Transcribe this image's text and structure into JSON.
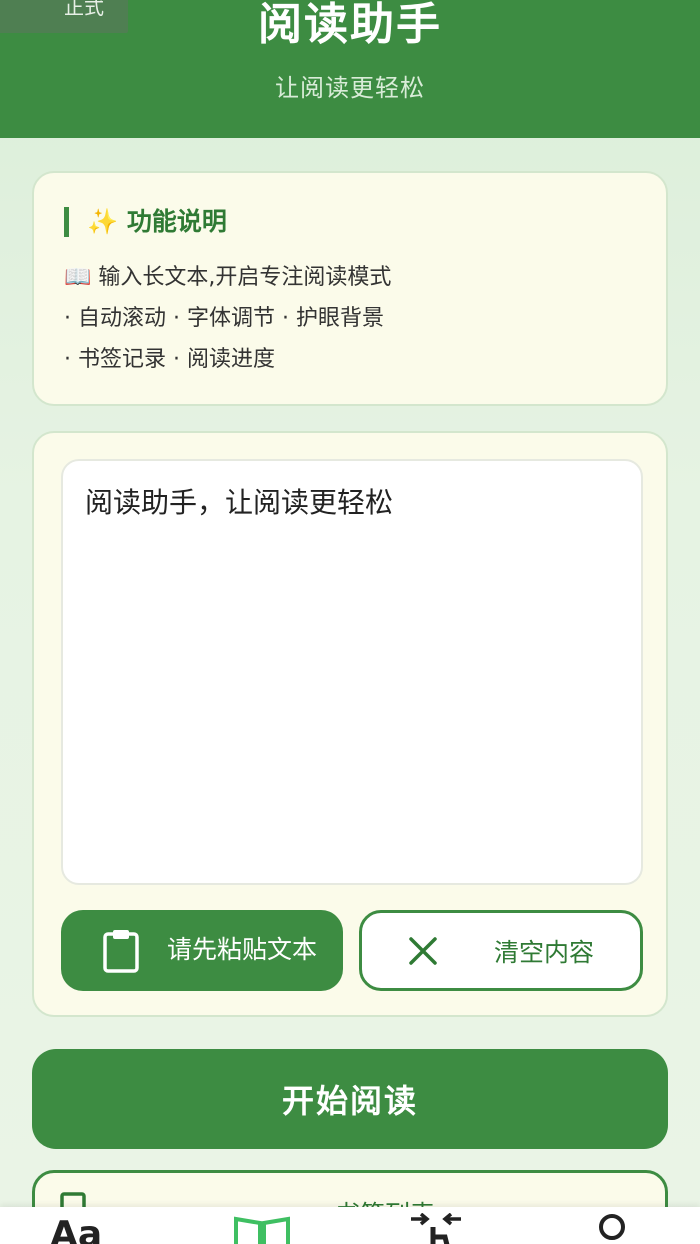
{
  "header": {
    "env_badge": "正式",
    "title": "阅读助手",
    "subtitle": "让阅读更轻松"
  },
  "info": {
    "title": "✨ 功能说明",
    "lines": [
      "📖 输入长文本,开启专注阅读模式",
      "· 自动滚动 · 字体调节 · 护眼背景",
      "· 书签记录 · 阅读进度"
    ]
  },
  "editor": {
    "text": "阅读助手，让阅读更轻松",
    "paste_label": "请先粘贴文本",
    "clear_label": "清空内容"
  },
  "start_label": "开始阅读",
  "bookmarks": {
    "title": "书签列表"
  },
  "tabs": {
    "font_label": "Aa"
  },
  "colors": {
    "primary": "#3d8c42",
    "card_bg": "#fbfbea"
  },
  "icons": [
    "clipboard-icon",
    "close-icon",
    "bookmark-icon",
    "font-size-icon",
    "book-icon",
    "scroll-icon",
    "profile-icon"
  ]
}
